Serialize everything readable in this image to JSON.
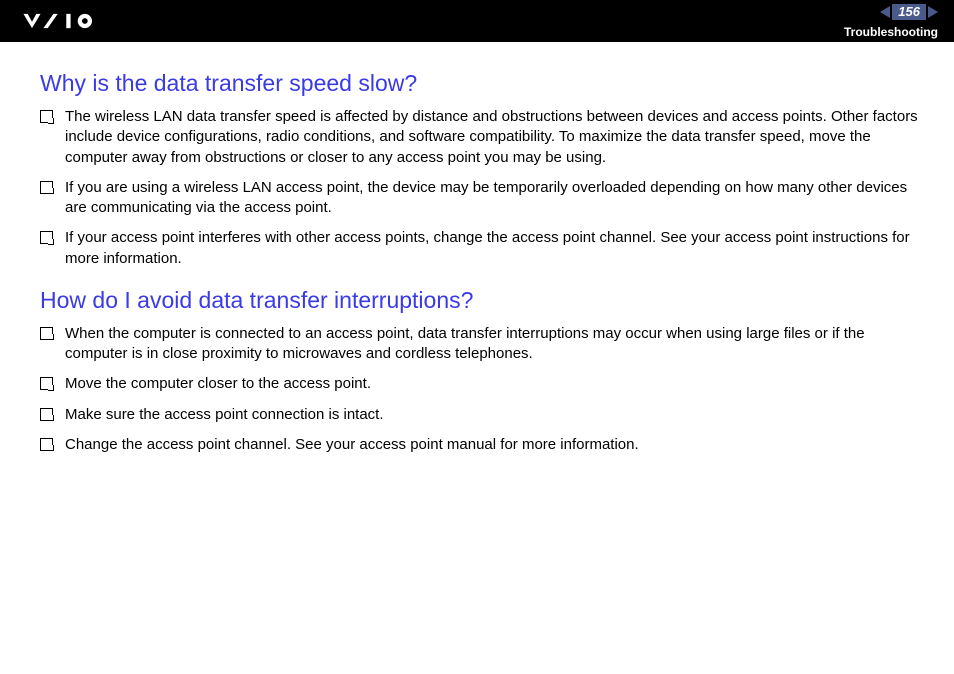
{
  "header": {
    "page_number": "156",
    "section": "Troubleshooting"
  },
  "sections": [
    {
      "heading": "Why is the data transfer speed slow?",
      "items": [
        "The wireless LAN data transfer speed is affected by distance and obstructions between devices and access points. Other factors include device configurations, radio conditions, and software compatibility. To maximize the data transfer speed, move the computer away from obstructions or closer to any access point you may be using.",
        "If you are using a wireless LAN access point, the device may be temporarily overloaded depending on how many other devices are communicating via the access point.",
        "If your access point interferes with other access points, change the access point channel. See your access point instructions for more information."
      ]
    },
    {
      "heading": "How do I avoid data transfer interruptions?",
      "items": [
        "When the computer is connected to an access point, data transfer interruptions may occur when using large files or if the computer is in close proximity to microwaves and cordless telephones.",
        "Move the computer closer to the access point.",
        "Make sure the access point connection is intact.",
        "Change the access point channel. See your access point manual for more information."
      ]
    }
  ]
}
